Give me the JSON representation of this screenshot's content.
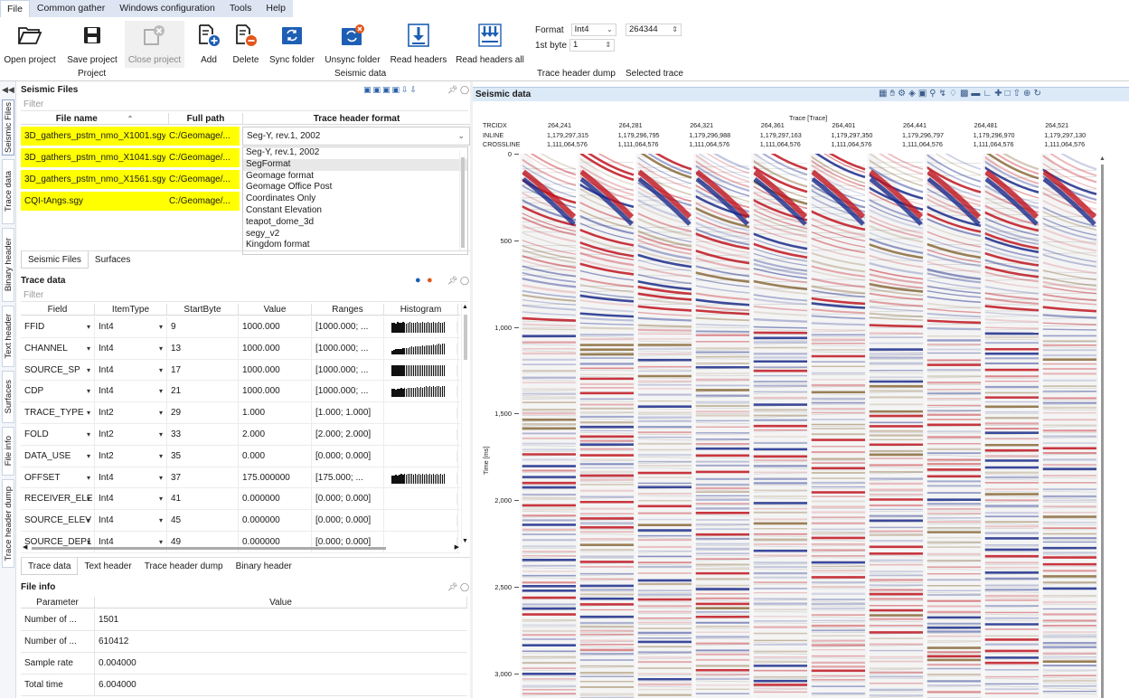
{
  "menu": {
    "items": [
      "File",
      "Common gather",
      "Windows configuration",
      "Tools",
      "Help"
    ]
  },
  "ribbon": {
    "buttons": [
      {
        "label": "Open project",
        "icon": "folder-open-icon"
      },
      {
        "label": "Save project",
        "icon": "floppy-disk-icon"
      },
      {
        "label": "Close project",
        "icon": "close-project-icon",
        "disabled": true
      },
      {
        "label": "Add",
        "icon": "add-file-icon"
      },
      {
        "label": "Delete",
        "icon": "delete-file-icon"
      },
      {
        "label": "Sync folder",
        "icon": "sync-folder-icon"
      },
      {
        "label": "Unsync folder",
        "icon": "unsync-folder-icon"
      },
      {
        "label": "Read headers",
        "icon": "download-icon"
      },
      {
        "label": "Read headers all",
        "icon": "download-all-icon"
      }
    ],
    "groups": {
      "project": "Project",
      "seismic_data": "Seismic data",
      "trace_header_dump": "Trace header dump",
      "selected_trace": "Selected trace"
    },
    "format_label": "Format",
    "format_value": "Int4",
    "first_byte_label": "1st byte",
    "first_byte_value": "1",
    "selected_trace_value": "264344"
  },
  "side_tabs": [
    "Seismic Files",
    "Trace data",
    "Binary header",
    "Text header",
    "Surfaces",
    "File info",
    "Trace header dump"
  ],
  "seismic_files": {
    "title": "Seismic Files",
    "filter_placeholder": "Filter",
    "columns": [
      "File name",
      "Full path",
      "Trace header format"
    ],
    "rows": [
      {
        "name": "3D_gathers_pstm_nmo_X1001.sgy",
        "path": "C:/Geomage/..."
      },
      {
        "name": "3D_gathers_pstm_nmo_X1041.sgy",
        "path": "C:/Geomage/..."
      },
      {
        "name": "3D_gathers_pstm_nmo_X1561.sgy",
        "path": "C:/Geomage/..."
      },
      {
        "name": "CQI-tAngs.sgy",
        "path": "C:/Geomage/..."
      }
    ],
    "format_selected": "Seg-Y, rev.1, 2002",
    "format_options": [
      "Seg-Y, rev.1, 2002",
      "SegFormat",
      "Geomage format",
      "Geomage Office Post",
      "Coordinates Only",
      "Constant Elevation",
      "teapot_dome_3d",
      "segy_v2",
      "Kingdom format"
    ],
    "format_highlighted": 1,
    "tabs": [
      "Seismic Files",
      "Surfaces"
    ]
  },
  "trace_data": {
    "title": "Trace data",
    "filter_placeholder": "Filter",
    "columns": [
      "Field",
      "ItemType",
      "StartByte",
      "Value",
      "Ranges",
      "Histogram"
    ],
    "rows": [
      {
        "field": "FFID",
        "type": "Int4",
        "start": "9",
        "value": "1000.000",
        "range": "[1000.000; ...",
        "hist": [
          0.9,
          0.95,
          0.85,
          1,
          0.9,
          0.95,
          1,
          0.9,
          0.85,
          0.95,
          1,
          0.9,
          0.95,
          0.9,
          1,
          0.95,
          0.9,
          1,
          0.95,
          0.9,
          1,
          0.9,
          0.95,
          1,
          0.9,
          0.95,
          1,
          0.9,
          0.95,
          1
        ]
      },
      {
        "field": "CHANNEL",
        "type": "Int4",
        "start": "13",
        "value": "1000.000",
        "range": "[1000.000; ...",
        "hist": [
          0.35,
          0.4,
          0.45,
          0.5,
          0.45,
          0.5,
          0.55,
          0.6,
          0.55,
          0.6,
          0.65,
          0.7,
          0.65,
          0.7,
          0.75,
          0.7,
          0.75,
          0.8,
          0.75,
          0.8,
          0.85,
          0.8,
          0.85,
          0.9,
          0.85,
          0.9,
          0.95,
          0.9,
          0.95,
          1
        ]
      },
      {
        "field": "SOURCE_SP",
        "type": "Int4",
        "start": "17",
        "value": "1000.000",
        "range": "[1000.000; ...",
        "hist": [
          1,
          1,
          1,
          1,
          1,
          1,
          1,
          1,
          1,
          1,
          1,
          1,
          1,
          1,
          1,
          1,
          1,
          1,
          1,
          1,
          1,
          1,
          1,
          1,
          1,
          1,
          1,
          1,
          1,
          1
        ]
      },
      {
        "field": "CDP",
        "type": "Int4",
        "start": "21",
        "value": "1000.000",
        "range": "[1000.000; ...",
        "hist": [
          0.75,
          0.8,
          0.7,
          0.8,
          0.75,
          0.85,
          0.8,
          0.85,
          0.8,
          0.9,
          0.85,
          0.9,
          0.85,
          0.9,
          0.95,
          0.9,
          0.95,
          0.9,
          0.95,
          1,
          0.95,
          1,
          0.95,
          1,
          0.95,
          1,
          1,
          0.95,
          1,
          1
        ]
      },
      {
        "field": "TRACE_TYPE",
        "type": "Int2",
        "start": "29",
        "value": "1.000",
        "range": "[1.000; 1.000]",
        "hist": []
      },
      {
        "field": "FOLD",
        "type": "Int2",
        "start": "33",
        "value": "2.000",
        "range": "[2.000; 2.000]",
        "hist": []
      },
      {
        "field": "DATA_USE",
        "type": "Int2",
        "start": "35",
        "value": "0.000",
        "range": "[0.000; 0.000]",
        "hist": []
      },
      {
        "field": "OFFSET",
        "type": "Int4",
        "start": "37",
        "value": "175.000000",
        "range": "[175.000; ...",
        "hist": [
          0.7,
          0.75,
          0.8,
          0.75,
          0.8,
          0.85,
          0.8,
          0.85,
          0.8,
          0.85,
          0.9,
          0.85,
          0.8,
          0.85,
          0.8,
          0.85,
          0.8,
          0.85,
          0.8,
          0.85,
          0.8,
          0.85,
          0.8,
          0.85,
          0.8,
          0.85,
          0.8,
          0.85,
          0.8,
          0.85
        ]
      },
      {
        "field": "RECEIVER_ELE",
        "type": "Int4",
        "start": "41",
        "value": "0.000000",
        "range": "[0.000; 0.000]",
        "hist": []
      },
      {
        "field": "SOURCE_ELEV",
        "type": "Int4",
        "start": "45",
        "value": "0.000000",
        "range": "[0.000; 0.000]",
        "hist": []
      },
      {
        "field": "SOURCE_DEP1",
        "type": "Int4",
        "start": "49",
        "value": "0.000000",
        "range": "[0.000; 0.000]",
        "hist": []
      }
    ],
    "tabs": [
      "Trace data",
      "Text header",
      "Trace header dump",
      "Binary header"
    ]
  },
  "file_info": {
    "title": "File info",
    "columns": [
      "Parameter",
      "Value"
    ],
    "rows": [
      {
        "param": "Number of ...",
        "value": "1501"
      },
      {
        "param": "Number of ...",
        "value": "610412"
      },
      {
        "param": "Sample rate",
        "value": "0.004000"
      },
      {
        "param": "Total time",
        "value": "6.004000"
      }
    ]
  },
  "seismic_data": {
    "title": "Seismic data",
    "x_axis_title": "Trace [Trace]",
    "y_axis_title": "Time [ms]",
    "header_labels": [
      "TRCIDX",
      "INLINE",
      "CROSSLINE"
    ],
    "columns": [
      {
        "trcidx": "264,241",
        "inline": "1,179,297,315",
        "crossline": "1,111,064,576"
      },
      {
        "trcidx": "264,281",
        "inline": "1,179,296,795",
        "crossline": "1,111,064,576"
      },
      {
        "trcidx": "264,321",
        "inline": "1,179,296,988",
        "crossline": "1,111,064,576"
      },
      {
        "trcidx": "264,361",
        "inline": "1,179,297,163",
        "crossline": "1,111,064,576"
      },
      {
        "trcidx": "264,401",
        "inline": "1,179,297,350",
        "crossline": "1,111,064,576"
      },
      {
        "trcidx": "264,441",
        "inline": "1,179,296,797",
        "crossline": "1,111,064,576"
      },
      {
        "trcidx": "264,481",
        "inline": "1,179,296,970",
        "crossline": "1,111,064,576"
      },
      {
        "trcidx": "264,521",
        "inline": "1,179,297,130",
        "crossline": "1,111,064,576"
      }
    ],
    "y_ticks": [
      "0",
      "500",
      "1,000",
      "1,500",
      "2,000",
      "2,500",
      "3,000"
    ],
    "colors": {
      "positive": "#c0141e",
      "negative": "#1a2a8a"
    }
  }
}
